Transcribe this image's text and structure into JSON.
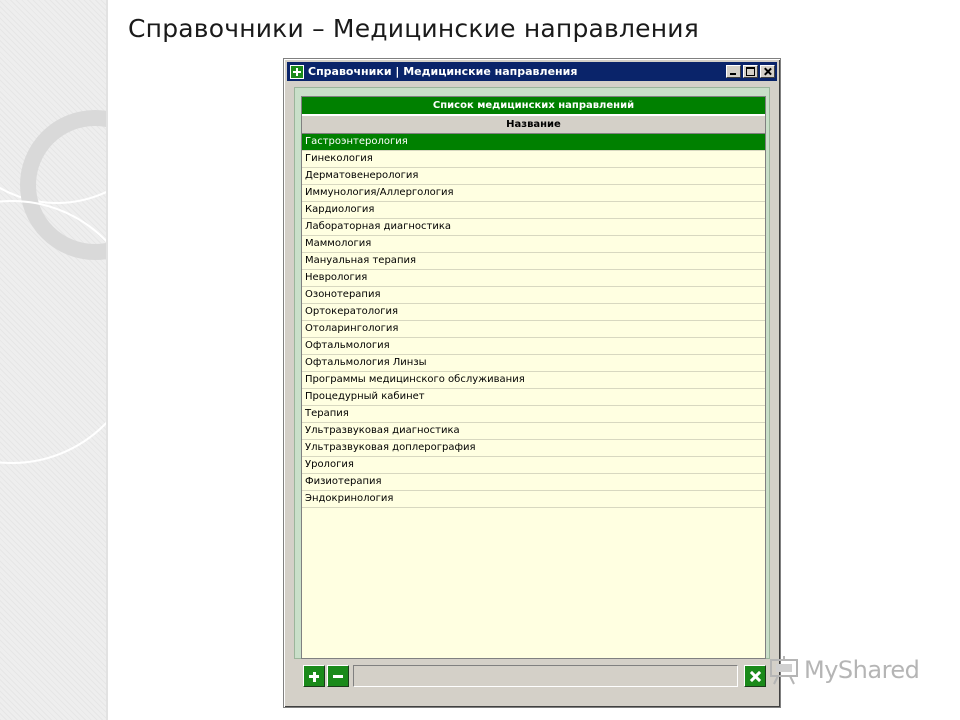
{
  "slide": {
    "title": "Справочники – Медицинские направления"
  },
  "window": {
    "title": "Справочники | Медицинские направления"
  },
  "grid": {
    "caption": "Список медицинских направлений",
    "column_header": "Название",
    "selected_index": 0,
    "rows": [
      "Гастроэнтерология",
      "Гинекология",
      "Дерматовенерология",
      "Иммунология/Аллергология",
      "Кардиология",
      "Лабораторная диагностика",
      "Маммология",
      "Мануальная терапия",
      "Неврология",
      "Озонотерапия",
      "Ортокератология",
      "Отоларингология",
      "Офтальмология",
      "Офтальмология Линзы",
      "Программы медицинского обслуживания",
      "Процедурный кабинет",
      "Терапия",
      "Ультразвуковая диагностика",
      "Ультразвуковая доплерография",
      "Урология",
      "Физиотерапия",
      "Эндокринология"
    ]
  },
  "toolbar": {
    "add_icon": "plus-icon",
    "remove_icon": "minus-icon",
    "close_icon": "close-icon"
  },
  "watermark": {
    "text": "MyShared"
  },
  "colors": {
    "accent_green": "#008000",
    "grid_background": "#ffffe1",
    "titlebar": "#0a246a",
    "form_background": "#c9dfc9"
  }
}
